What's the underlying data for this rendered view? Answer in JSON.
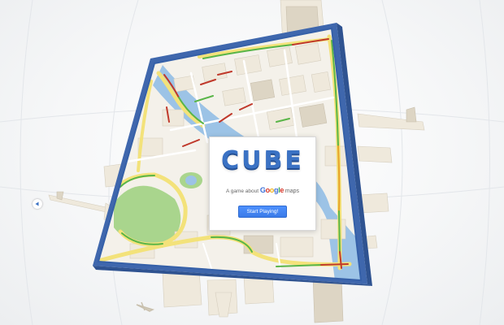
{
  "game": {
    "title": "CUBE",
    "tagline_prefix": "A game about",
    "brand_letters": [
      "G",
      "o",
      "o",
      "g",
      "l",
      "e"
    ],
    "brand_suffix": "maps",
    "start_label": "Start Playing!"
  },
  "controls": {
    "rotate_left_icon": "left-triangle-arrow"
  },
  "colors": {
    "cube_frame": "#3f67ad",
    "title": "#3b72c4",
    "water": "#9cc3e6",
    "park": "#a9d58d",
    "road_major": "#f3e27a",
    "traffic_green": "#59b548",
    "traffic_red": "#c0392b",
    "button": "#4d90fe"
  }
}
